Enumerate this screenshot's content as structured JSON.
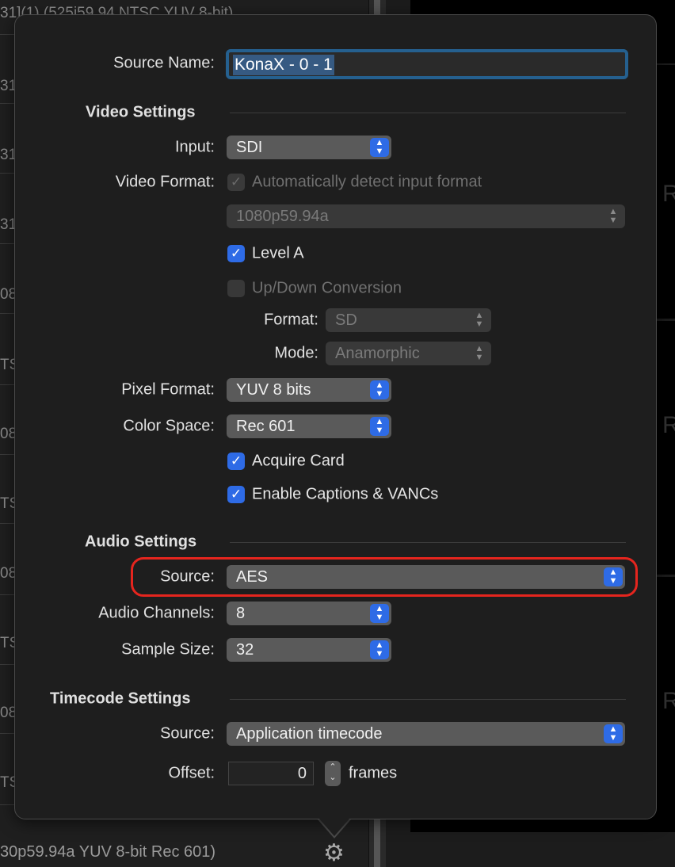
{
  "background": {
    "list_row_prefixes": [
      "31](1) (525i59.94 NTSC YUV 8-bit)",
      "31",
      "31",
      "31",
      "08",
      "TS",
      "08",
      "TS",
      "08",
      "TS",
      "08",
      "TS"
    ],
    "bottom_row_text": "30p59.94a YUV 8-bit Rec 601)",
    "right_letter": "R"
  },
  "popover": {
    "source_name": {
      "label": "Source Name:",
      "value": "KonaX - 0 - 1"
    },
    "video": {
      "header": "Video Settings",
      "input": {
        "label": "Input:",
        "value": "SDI"
      },
      "video_format": {
        "label": "Video Format:",
        "auto_detect_label": "Automatically detect input format",
        "auto_detect_checked": true,
        "format_value": "1080p59.94a"
      },
      "level_a": {
        "label": "Level A",
        "checked": true
      },
      "updown": {
        "label": "Up/Down Conversion",
        "checked": false
      },
      "format": {
        "label": "Format:",
        "value": "SD"
      },
      "mode": {
        "label": "Mode:",
        "value": "Anamorphic"
      },
      "pixel_format": {
        "label": "Pixel Format:",
        "value": "YUV 8 bits"
      },
      "color_space": {
        "label": "Color Space:",
        "value": "Rec 601"
      },
      "acquire_card": {
        "label": "Acquire Card",
        "checked": true
      },
      "captions": {
        "label": "Enable Captions & VANCs",
        "checked": true
      }
    },
    "audio": {
      "header": "Audio Settings",
      "source": {
        "label": "Source:",
        "value": "AES"
      },
      "channels": {
        "label": "Audio Channels:",
        "value": "8"
      },
      "sample_size": {
        "label": "Sample Size:",
        "value": "32"
      }
    },
    "timecode": {
      "header": "Timecode Settings",
      "source": {
        "label": "Source:",
        "value": "Application timecode"
      },
      "offset": {
        "label": "Offset:",
        "value": "0",
        "unit": "frames"
      }
    }
  },
  "colors": {
    "accent": "#2e6be6",
    "highlight": "#e5251e",
    "focus": "#25608f"
  }
}
